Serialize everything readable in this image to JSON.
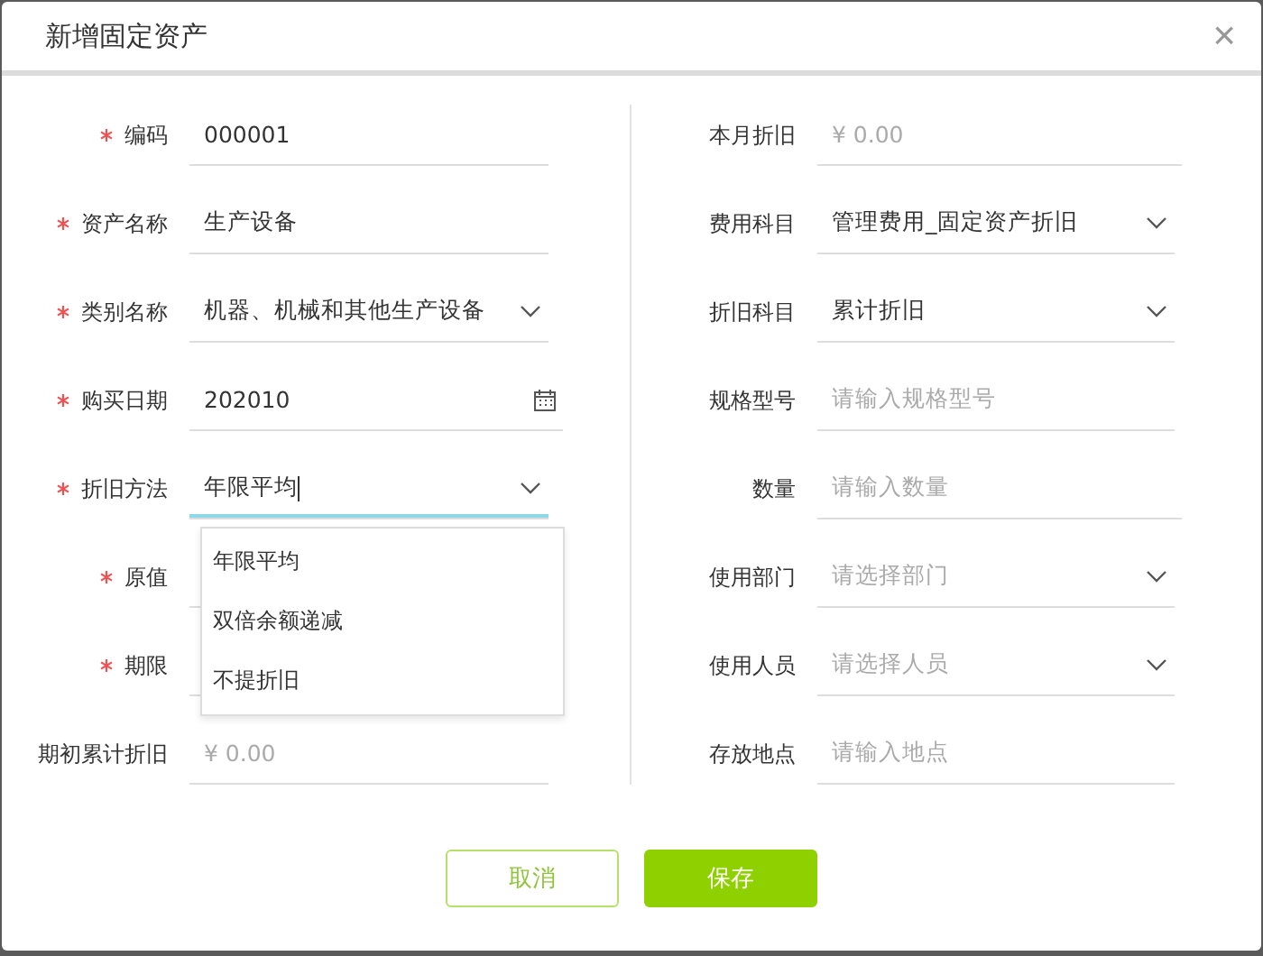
{
  "dialog": {
    "title": "新增固定资产",
    "close": "×"
  },
  "left_fields": [
    {
      "label": "编码",
      "required": true,
      "kind": "text",
      "value": "000001"
    },
    {
      "label": "资产名称",
      "required": true,
      "kind": "text",
      "value": "生产设备"
    },
    {
      "label": "类别名称",
      "required": true,
      "kind": "select",
      "value": "机器、机械和其他生产设备"
    },
    {
      "label": "购买日期",
      "required": true,
      "kind": "date",
      "value": "202010"
    },
    {
      "label": "折旧方法",
      "required": true,
      "kind": "select",
      "value": "年限平均",
      "focused": true
    },
    {
      "label": "原值",
      "required": true,
      "kind": "text"
    },
    {
      "label": "期限",
      "required": true,
      "kind": "period"
    },
    {
      "label": "期初累计折旧",
      "required": false,
      "kind": "text",
      "placeholder": "¥ 0.00"
    }
  ],
  "right_fields": [
    {
      "label": "本月折旧",
      "kind": "text",
      "placeholder": "¥ 0.00"
    },
    {
      "label": "费用科目",
      "kind": "select",
      "value": "管理费用_固定资产折旧"
    },
    {
      "label": "折旧科目",
      "kind": "select",
      "value": "累计折旧"
    },
    {
      "label": "规格型号",
      "kind": "text",
      "placeholder": "请输入规格型号"
    },
    {
      "label": "数量",
      "kind": "text",
      "placeholder": "请输入数量"
    },
    {
      "label": "使用部门",
      "kind": "select",
      "placeholder": "请选择部门"
    },
    {
      "label": "使用人员",
      "kind": "select",
      "placeholder": "请选择人员"
    },
    {
      "label": "存放地点",
      "kind": "text",
      "placeholder": "请输入地点"
    }
  ],
  "dropdown_options": [
    "年限平均",
    "双倍余额递减",
    "不提折旧"
  ],
  "buttons": [
    {
      "label": "取消",
      "kind": "secondary"
    },
    {
      "label": "保存",
      "kind": "primary"
    }
  ]
}
